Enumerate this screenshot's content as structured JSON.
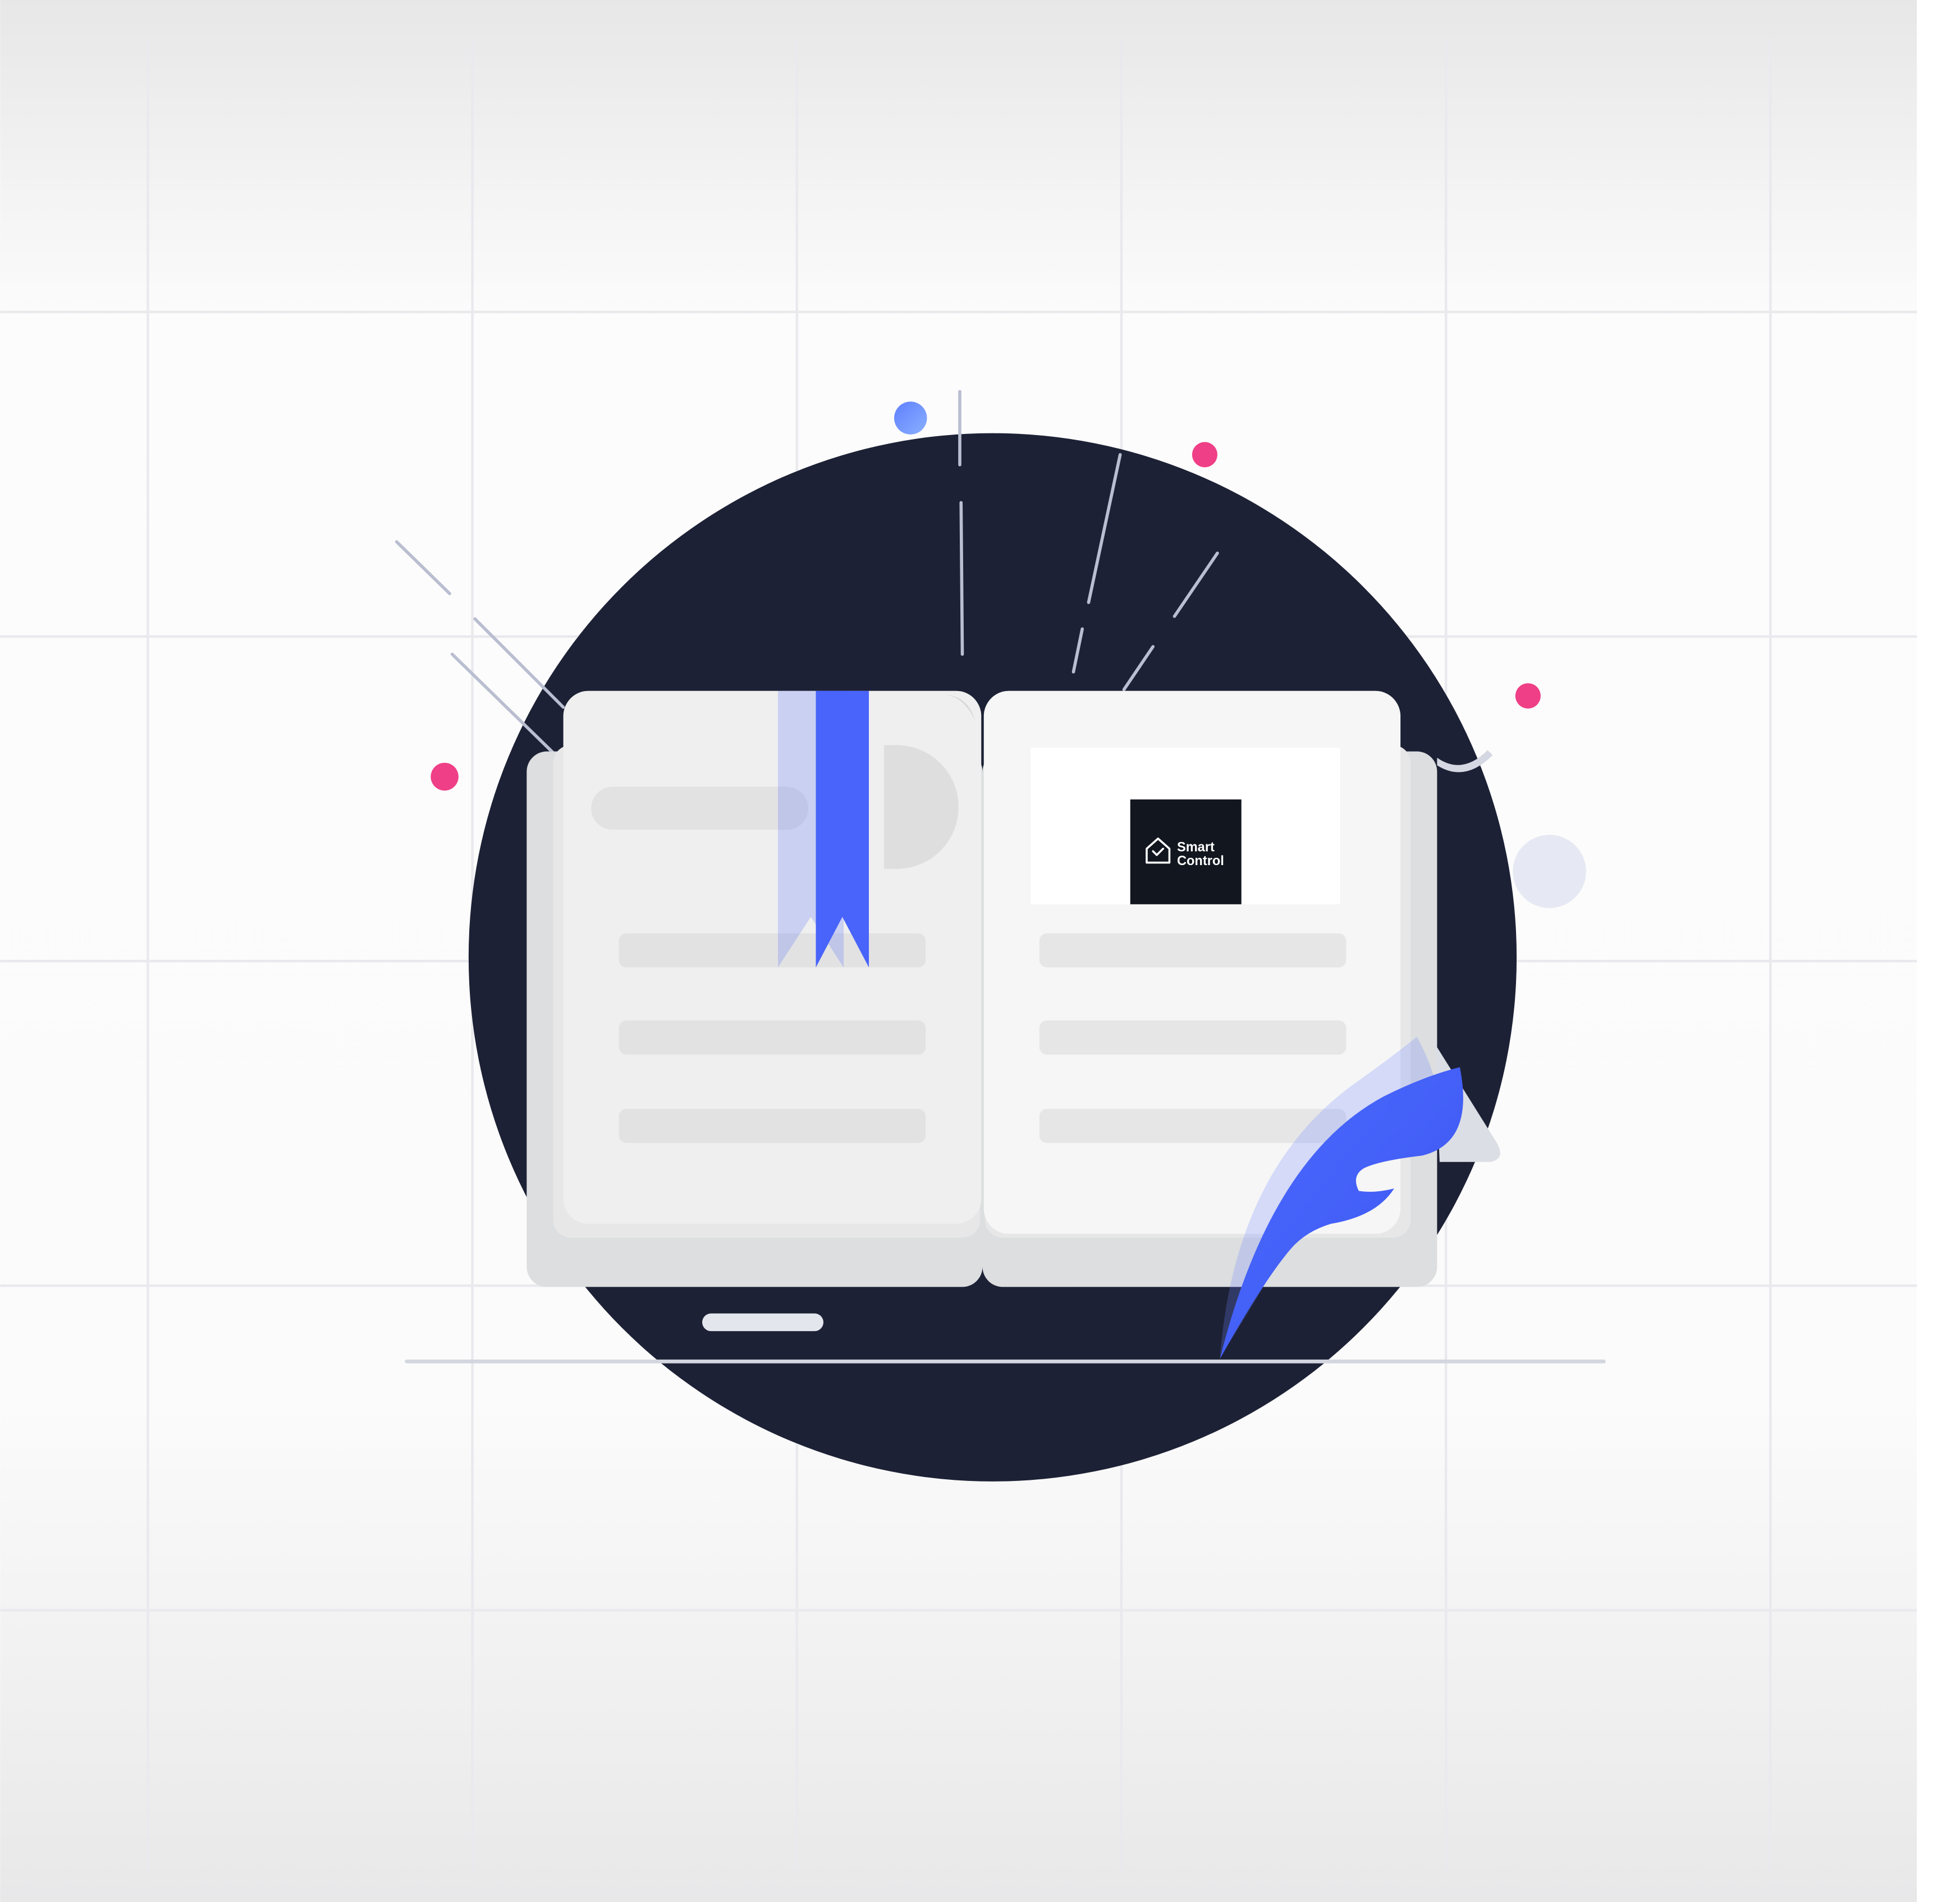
{
  "illustration": {
    "subject": "open-book-with-bookmark-and-quill",
    "colors": {
      "circle": "#1d2135",
      "accent_blue": "#4864fa",
      "accent_pink": "#ef3f86",
      "page": "#f3f3f4",
      "line": "#b9bed0",
      "logo_bg": "#11161f"
    },
    "logo": {
      "line1": "Smart",
      "line2": "Control",
      "icon": "house-check-icon"
    }
  }
}
